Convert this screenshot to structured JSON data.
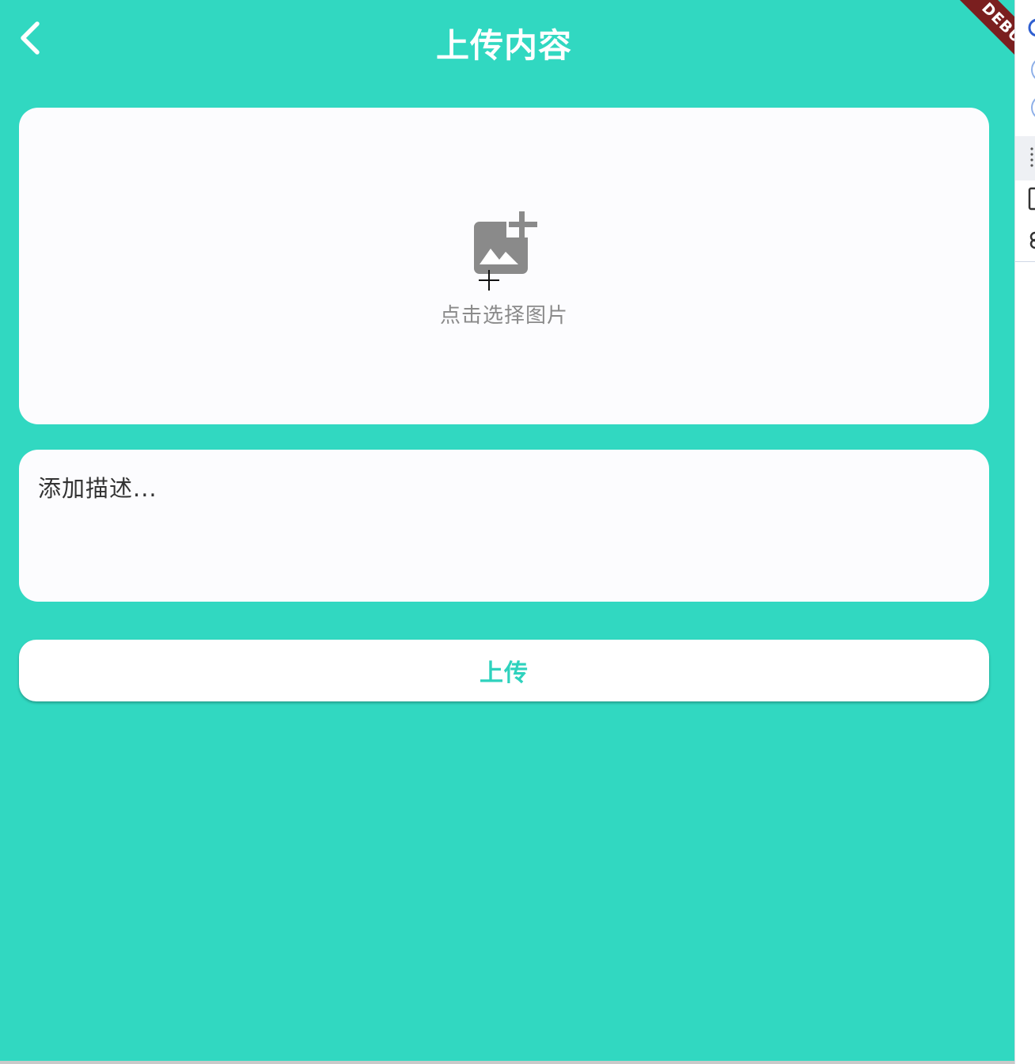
{
  "app_bar": {
    "title": "上传内容",
    "back_icon": "chevron-left-icon",
    "debug_label": "DEBUG"
  },
  "image_picker": {
    "icon": "add-photo-icon",
    "hint": "点击选择图片"
  },
  "description": {
    "placeholder": "添加描述...",
    "value": ""
  },
  "upload_button": {
    "label": "上传"
  },
  "colors": {
    "background": "#31d8c1",
    "card": "#fcfcfe",
    "accent": "#2ed2bd",
    "debug_ribbon": "#7a1f1f",
    "hint_text": "#8a8a8a"
  }
}
